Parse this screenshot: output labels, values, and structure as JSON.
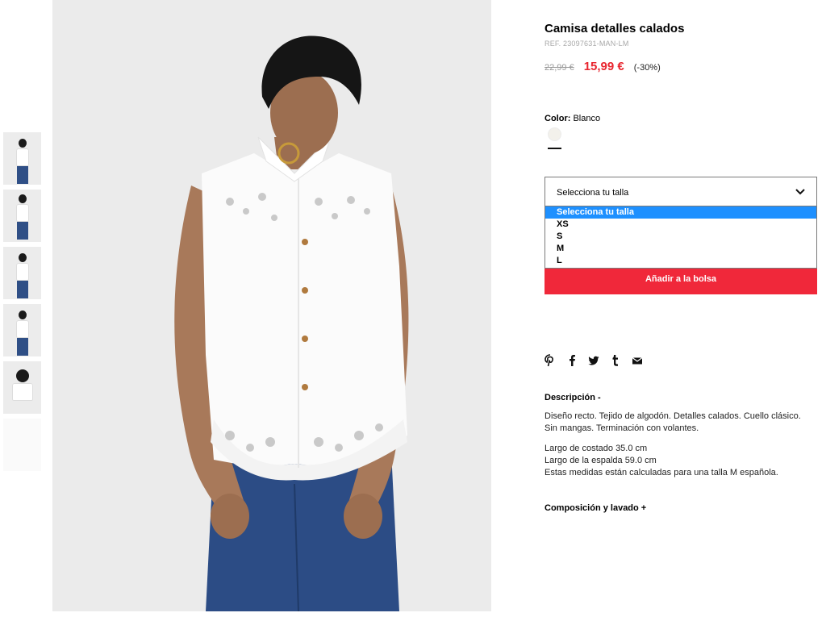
{
  "product": {
    "title": "Camisa detalles calados",
    "ref": "REF. 23097631-MAN-LM",
    "old_price": "22,99 €",
    "new_price": "15,99 €",
    "discount": "(-30%)"
  },
  "color": {
    "label": "Color:",
    "value": "Blanco",
    "swatch_color": "#f3f1eb"
  },
  "size": {
    "selected": "Selecciona tu talla",
    "options": [
      "Selecciona tu talla",
      "XS",
      "S",
      "M",
      "L"
    ]
  },
  "add_to_bag": "Añadir a la bolsa",
  "share_icons": [
    "pinterest-icon",
    "facebook-icon",
    "twitter-icon",
    "tumblr-icon",
    "email-icon"
  ],
  "description": {
    "heading": "Descripción -",
    "paragraph": "Diseño recto. Tejido de algodón. Detalles calados. Cuello clásico. Sin mangas. Terminación con volantes.",
    "measure_1": "Largo de costado 35.0 cm",
    "measure_2": "Largo de la espalda 59.0 cm",
    "measure_3": "Estas medidas están calculadas para una talla M española."
  },
  "composition_heading": "Composición y lavado +",
  "colors": {
    "price_red": "#e8262f",
    "button_red": "#f0283a",
    "select_highlight": "#1e90ff"
  }
}
